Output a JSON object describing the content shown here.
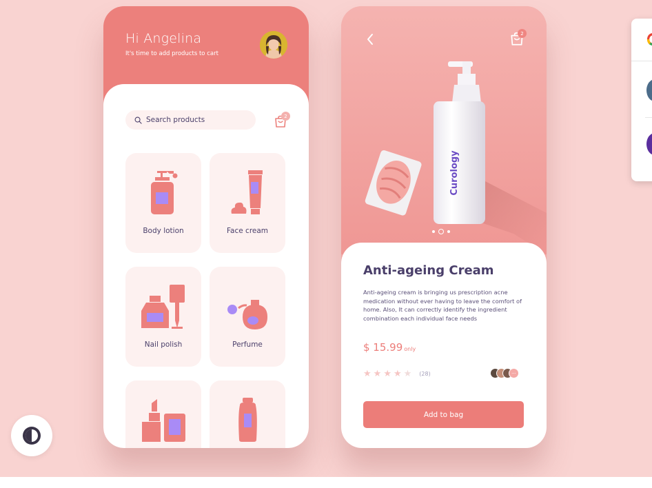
{
  "home": {
    "greeting": "Hi Angelina",
    "subtitle": "It's time to add products to cart",
    "search_placeholder": "Search products",
    "cart_count": "2",
    "categories": [
      {
        "label": "Body lotion",
        "icon": "body-lotion-icon"
      },
      {
        "label": "Face cream",
        "icon": "face-cream-icon"
      },
      {
        "label": "Nail polish",
        "icon": "nail-polish-icon"
      },
      {
        "label": "Perfume",
        "icon": "perfume-icon"
      },
      {
        "label": "",
        "icon": "makeup-icon"
      },
      {
        "label": "",
        "icon": "shampoo-icon"
      }
    ]
  },
  "detail": {
    "cart_count": "2",
    "brand_text": "Curology",
    "title": "Anti-ageing Cream",
    "description": "Anti-ageing cream is bringing us prescription acne medication without ever having to leave the comfort of home. Also, It can correctly identify the ingredient combination each individual face needs",
    "price": "$ 15.99",
    "price_suffix": "only",
    "rating": 4,
    "rating_max": 5,
    "review_count": "(28)",
    "reviewers_more": "···",
    "add_button": "Add to bag"
  },
  "colors": {
    "background": "#f9d3d1",
    "accent": "#ec807c",
    "tile": "#fdf1f0",
    "icon_purple": "#a98bf6",
    "text_dark": "#4a3f6a"
  }
}
